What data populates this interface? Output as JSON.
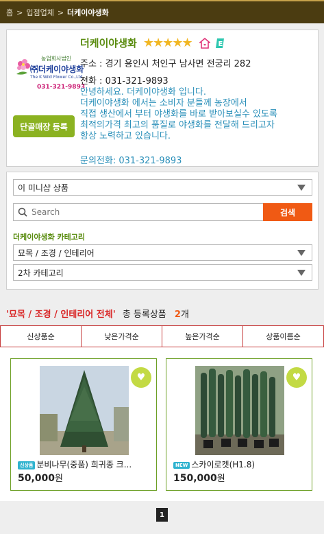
{
  "breadcrumb": {
    "home": "홈",
    "sep1": ">",
    "section": "입점업체",
    "sep2": ">",
    "current": "더케이야생화"
  },
  "shop": {
    "name": "더케이야생화",
    "stars": "★★★★★",
    "rating": 5,
    "address": "주소 : 경기 용인시 처인구 남사면 전궁리 282",
    "phone": "전화 : 031-321-9893",
    "description": [
      "안녕하세요. 더케이야생화 입니다.",
      "더케이야생화 에서는 소비자 분들께 농장에서",
      "직접 생산에서 부터 야생화를 바로 받아보실수 있도록",
      "최적의가격 최고의 품질로 야생화를 전달해 드리고자",
      "항상 노력하고 있습니다."
    ],
    "contact": "문의전화: 031-321-9893",
    "register_button": "단골매장 등록",
    "logo": {
      "line1": "농업회사법인",
      "brand": "㈜더케이야생화",
      "line2": "The K Wild Flower Co.,Ltd",
      "phone": "031-321-9893"
    }
  },
  "filters": {
    "scope_select": "이 미니샵 상품",
    "search_placeholder": "Search",
    "search_button": "검색",
    "category_label": "더케이야생화 카테고리",
    "category1": "묘목 / 조경 / 인테리어",
    "category2": "2차 카테고리"
  },
  "summary": {
    "category": "'묘목 / 조경 / 인테리어 전체'",
    "label": "총 등록상품",
    "count": "2",
    "unit": "개"
  },
  "sort": [
    "신상품순",
    "낮은가격순",
    "높은가격순",
    "상품이름순"
  ],
  "products": [
    {
      "tag": "신상품",
      "name": "분비나무(중품) 희귀종 크...",
      "price": "50,000",
      "won": "원"
    },
    {
      "tag": "NEW",
      "name": "스카이로켓(H1.8)",
      "price": "150,000",
      "won": "원"
    }
  ],
  "pagination": {
    "current": "1"
  },
  "colors": {
    "topbar": "#4b3c11",
    "accent_green": "#5a8c10",
    "search_orange": "#f05a14",
    "sort_red": "#c63b3b",
    "desc_blue": "#2a8fb9"
  }
}
